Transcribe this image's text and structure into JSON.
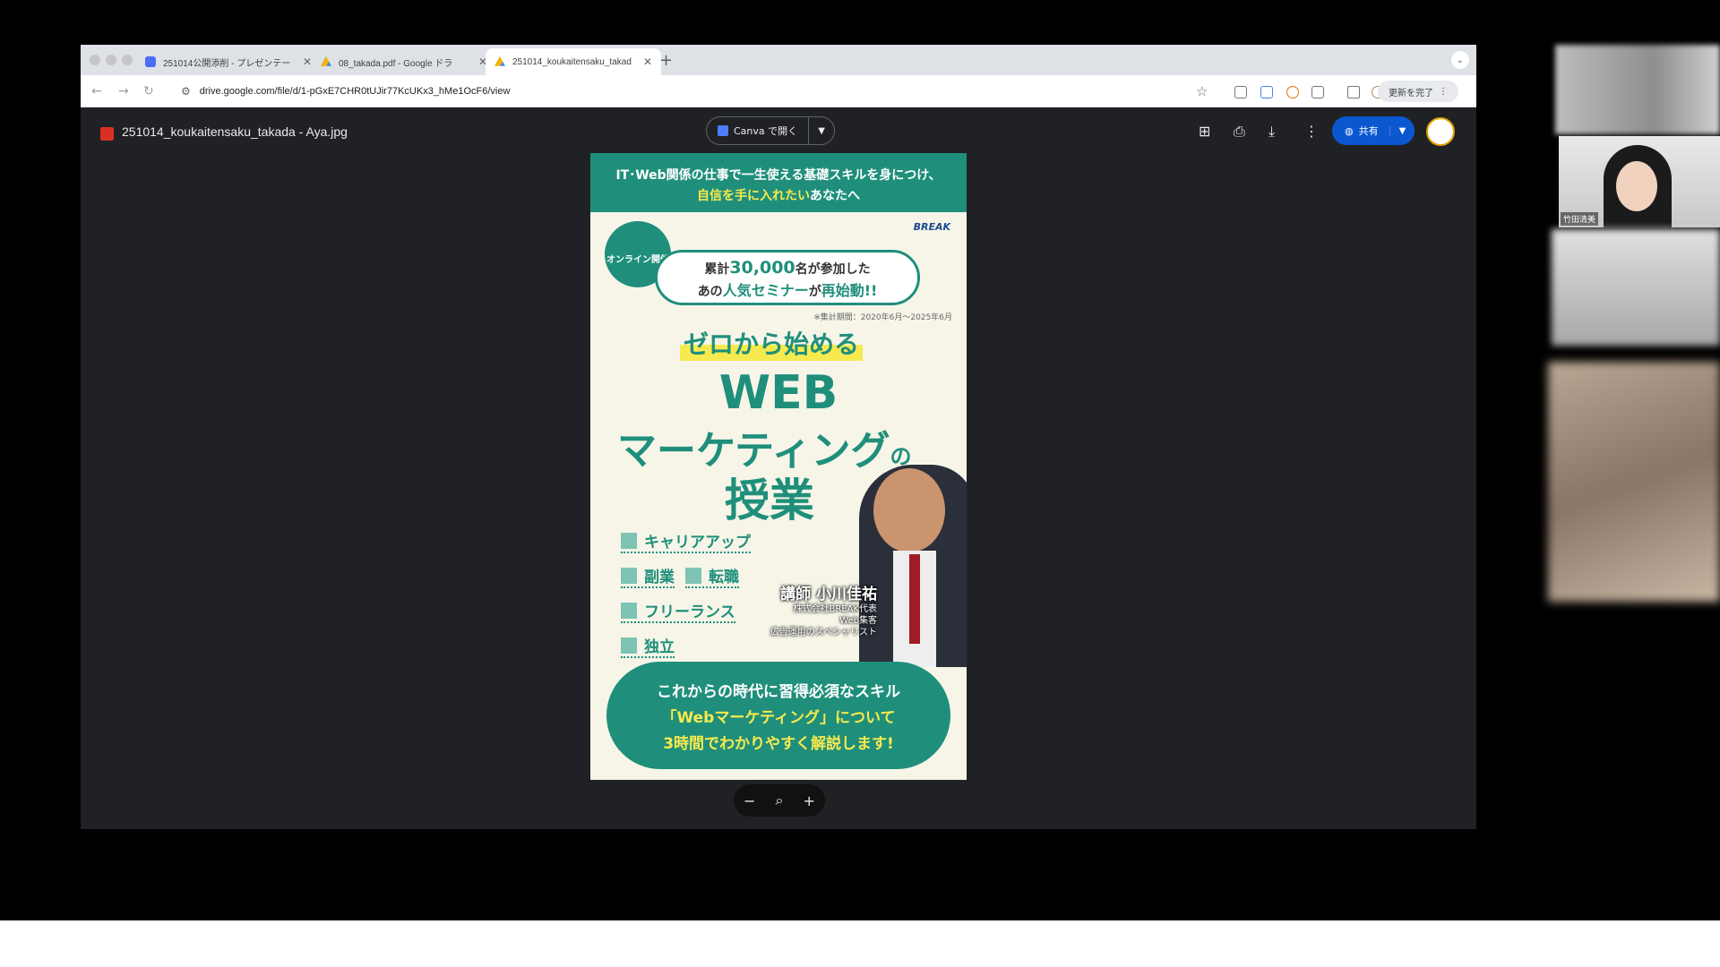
{
  "browser": {
    "tabs": [
      {
        "label": "251014公開添削 - プレゼンテー",
        "active": false
      },
      {
        "label": "08_takada.pdf - Google ドラ",
        "active": false
      },
      {
        "label": "251014_koukaitensaku_takad",
        "active": true
      }
    ],
    "url": "drive.google.com/file/d/1-pGxE7CHR0tUJir77KcUKx3_hMe1OcF6/view",
    "update_label": "更新を完了"
  },
  "viewer": {
    "filename": "251014_koukaitensaku_takada - Aya.jpg",
    "open_with_label": "Canva で開く",
    "share_label": "共有"
  },
  "poster": {
    "banner_line1": "IT･Web関係の仕事で一生使える基礎スキルを身につけ、",
    "banner_line2_highlight": "自信を手に入れたい",
    "banner_line2_rest": "あなたへ",
    "brand": "BREAK",
    "badge": "オンライン開催",
    "bubble_pre": "累計",
    "bubble_num": "30,000",
    "bubble_mid": "名が参加した",
    "bubble_line2_pre": "あの",
    "bubble_line2_g1": "人気セミナー",
    "bubble_line2_mid": "が",
    "bubble_line2_g2": "再始動!!",
    "note": "※集計期間：2020年6月～2025年6月",
    "subtitle": "ゼロから始める",
    "title_line1": "WEB",
    "title_line2": "マーケティング",
    "title_line2_small": "の",
    "title_line3": "授業",
    "tags": [
      "キャリアアップ",
      "副業",
      "転職",
      "フリーランス",
      "独立"
    ],
    "lecturer_name": "講師 小川佳祐",
    "lecturer_role1": "株式会社BREAK代表",
    "lecturer_role2": "Web集客",
    "lecturer_role3": "広告運用のスペシャリスト",
    "cta_line1": "これからの時代に習得必須なスキル",
    "cta_line2": "「Webマーケティング」について",
    "cta_line3": "3時間でわかりやすく解説します!"
  },
  "participants": {
    "cam_name": "竹田清美"
  },
  "colors": {
    "accent_green": "#1f8f7b",
    "highlight_yellow": "#f7ea4f",
    "share_blue": "#0b57d0"
  }
}
